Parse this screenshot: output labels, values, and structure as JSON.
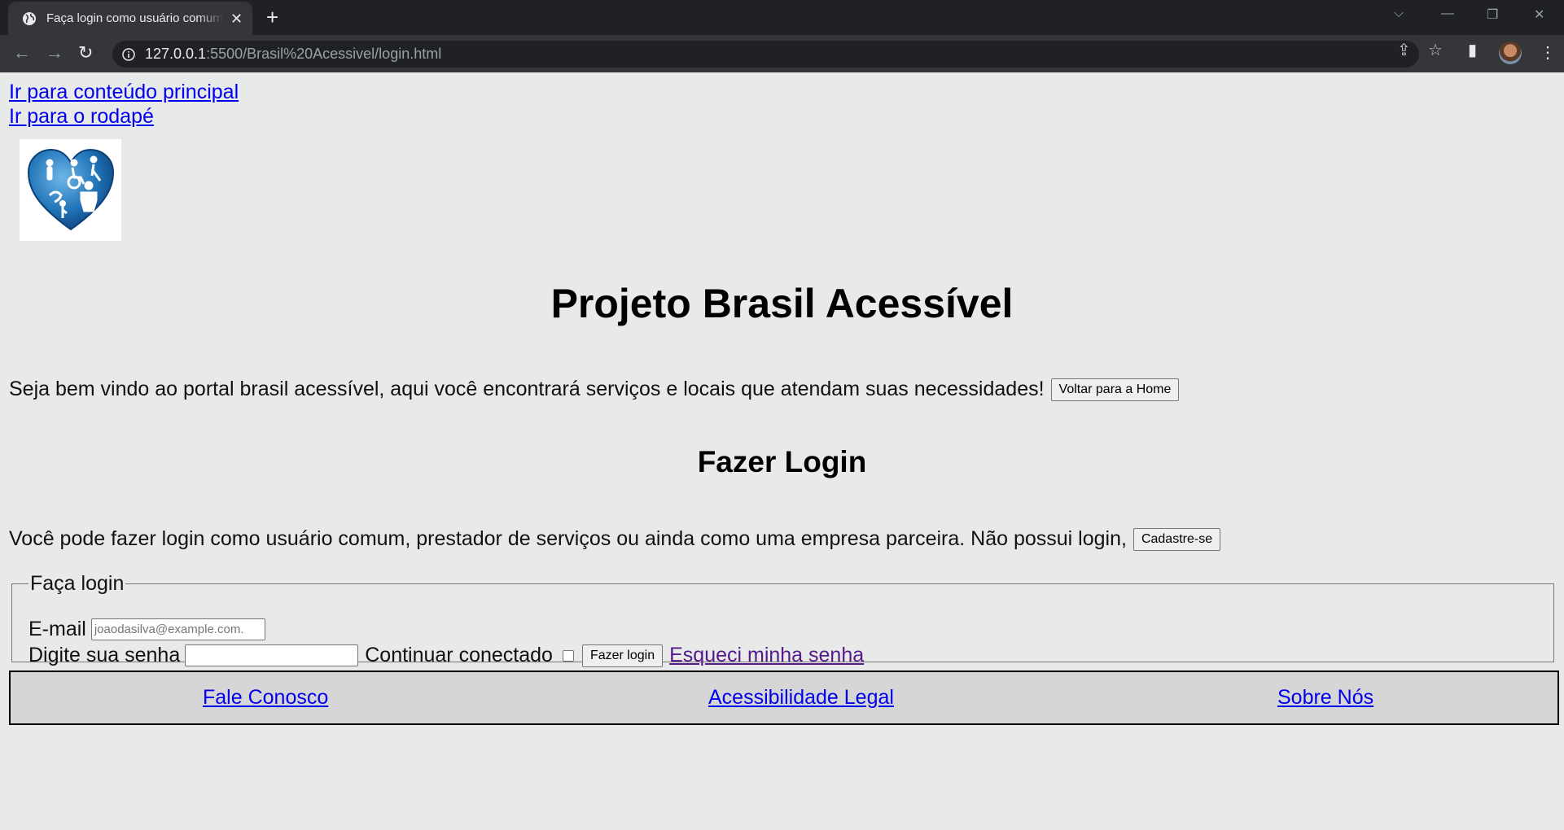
{
  "browser": {
    "tab_title": "Faça login como usuário comum",
    "url_host": "127.0.0.1",
    "url_path": ":5500/Brasil%20Acessivel/login.html"
  },
  "page": {
    "skip_links": [
      "Ir para conteúdo principal",
      "Ir para o rodapé"
    ],
    "title": "Projeto Brasil Acessível",
    "welcome_text": "Seja bem vindo ao portal brasil acessível, aqui você encontrará serviços e locais que atendam suas necessidades!",
    "home_button": "Voltar para a Home",
    "login_heading": "Fazer Login",
    "login_info": "Você pode fazer login como usuário comum, prestador de serviços ou ainda como uma empresa parceira. Não possui login,",
    "signup_button": "Cadastre-se",
    "form": {
      "legend": "Faça login",
      "email_label": "E-mail",
      "email_placeholder": "joaodasilva@example.com.",
      "password_label": "Digite sua senha",
      "password_value": "",
      "stay_connected_label": "Continuar conectado",
      "stay_connected_checked": false,
      "submit_button": "Fazer login",
      "forgot_link": "Esqueci minha senha"
    },
    "footer_links": [
      "Fale Conosco",
      "Acessibilidade Legal",
      "Sobre Nós"
    ]
  },
  "colors": {
    "page_bg": "#e8e9e9",
    "link": "#0000ee",
    "visited_link": "#551a8b",
    "footer_bg": "#d6d6d6",
    "logo_blue": "#1f73b7"
  }
}
